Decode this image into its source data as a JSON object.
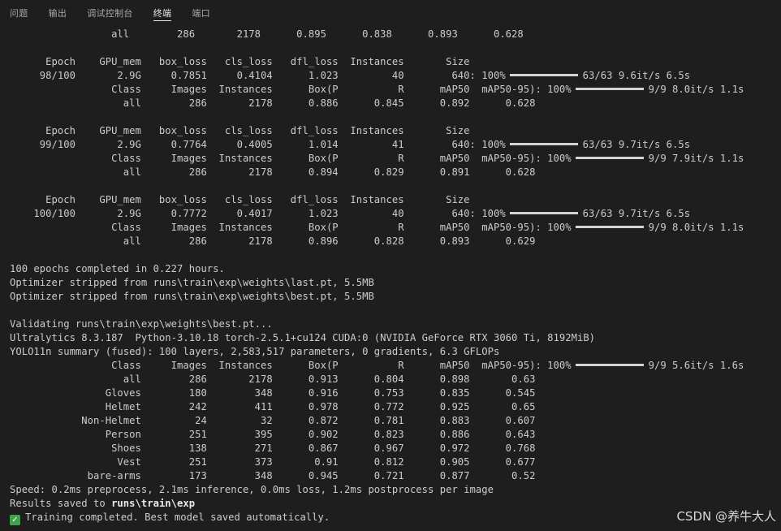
{
  "tabs": [
    {
      "label": "问题"
    },
    {
      "label": "输出"
    },
    {
      "label": "调试控制台"
    },
    {
      "label": "终端",
      "active": true
    },
    {
      "label": "端口"
    }
  ],
  "terminal": {
    "lines": [
      {
        "type": "text",
        "text": "                 all        286       2178      0.895      0.838      0.893      0.628"
      },
      {
        "type": "blank"
      },
      {
        "type": "text",
        "text": "      Epoch    GPU_mem   box_loss   cls_loss   dfl_loss  Instances       Size"
      },
      {
        "type": "bar",
        "before": "     98/100       2.9G     0.7851     0.4104      1.023         40        640: 100%",
        "after": "63/63 9.6it/s 6.5s"
      },
      {
        "type": "bar",
        "before": "                 Class     Images  Instances      Box(P          R      mAP50  mAP50-95): 100%",
        "after": "9/9 8.0it/s 1.1s"
      },
      {
        "type": "text",
        "text": "                   all        286       2178      0.886      0.845      0.892      0.628"
      },
      {
        "type": "blank"
      },
      {
        "type": "text",
        "text": "      Epoch    GPU_mem   box_loss   cls_loss   dfl_loss  Instances       Size"
      },
      {
        "type": "bar",
        "before": "     99/100       2.9G     0.7764     0.4005      1.014         41        640: 100%",
        "after": "63/63 9.7it/s 6.5s"
      },
      {
        "type": "bar",
        "before": "                 Class     Images  Instances      Box(P          R      mAP50  mAP50-95): 100%",
        "after": "9/9 7.9it/s 1.1s"
      },
      {
        "type": "text",
        "text": "                   all        286       2178      0.894      0.829      0.891      0.628"
      },
      {
        "type": "blank"
      },
      {
        "type": "text",
        "text": "      Epoch    GPU_mem   box_loss   cls_loss   dfl_loss  Instances       Size"
      },
      {
        "type": "bar",
        "before": "    100/100       2.9G     0.7772     0.4017      1.023         40        640: 100%",
        "after": "63/63 9.7it/s 6.5s"
      },
      {
        "type": "bar",
        "before": "                 Class     Images  Instances      Box(P          R      mAP50  mAP50-95): 100%",
        "after": "9/9 8.0it/s 1.1s"
      },
      {
        "type": "text",
        "text": "                   all        286       2178      0.896      0.828      0.893      0.629"
      },
      {
        "type": "blank"
      },
      {
        "type": "text",
        "text": "100 epochs completed in 0.227 hours."
      },
      {
        "type": "text",
        "text": "Optimizer stripped from runs\\train\\exp\\weights\\last.pt, 5.5MB"
      },
      {
        "type": "text",
        "text": "Optimizer stripped from runs\\train\\exp\\weights\\best.pt, 5.5MB"
      },
      {
        "type": "blank"
      },
      {
        "type": "text",
        "text": "Validating runs\\train\\exp\\weights\\best.pt..."
      },
      {
        "type": "text",
        "text": "Ultralytics 8.3.187  Python-3.10.18 torch-2.5.1+cu124 CUDA:0 (NVIDIA GeForce RTX 3060 Ti, 8192MiB)"
      },
      {
        "type": "text",
        "text": "YOLO11n summary (fused): 100 layers, 2,583,517 parameters, 0 gradients, 6.3 GFLOPs"
      },
      {
        "type": "bar",
        "before": "                 Class     Images  Instances      Box(P          R      mAP50  mAP50-95): 100%",
        "after": "9/9 5.6it/s 1.6s"
      },
      {
        "type": "text",
        "text": "                   all        286       2178      0.913      0.804      0.898       0.63"
      },
      {
        "type": "text",
        "text": "                Gloves        180        348      0.916      0.753      0.835      0.545"
      },
      {
        "type": "text",
        "text": "                Helmet        242        411      0.978      0.772      0.925       0.65"
      },
      {
        "type": "text",
        "text": "            Non-Helmet         24         32      0.872      0.781      0.883      0.607"
      },
      {
        "type": "text",
        "text": "                Person        251        395      0.902      0.823      0.886      0.643"
      },
      {
        "type": "text",
        "text": "                 Shoes        138        271      0.867      0.967      0.972      0.768"
      },
      {
        "type": "text",
        "text": "                  Vest        251        373       0.91      0.812      0.905      0.677"
      },
      {
        "type": "text",
        "text": "             bare-arms        173        348      0.945      0.721      0.877       0.52"
      },
      {
        "type": "text",
        "text": "Speed: 0.2ms preprocess, 2.1ms inference, 0.0ms loss, 1.2ms postprocess per image"
      },
      {
        "type": "results",
        "before": "Results saved to ",
        "bold": "runs\\train\\exp"
      },
      {
        "type": "check",
        "icon": "check-icon",
        "text": "Training completed. Best model saved automatically."
      }
    ]
  },
  "watermark": "CSDN @养牛大人",
  "colors": {
    "background": "#1e1e1e",
    "text": "#cccccc",
    "bar": "#d4d4d4",
    "check": "#3ea34b"
  }
}
